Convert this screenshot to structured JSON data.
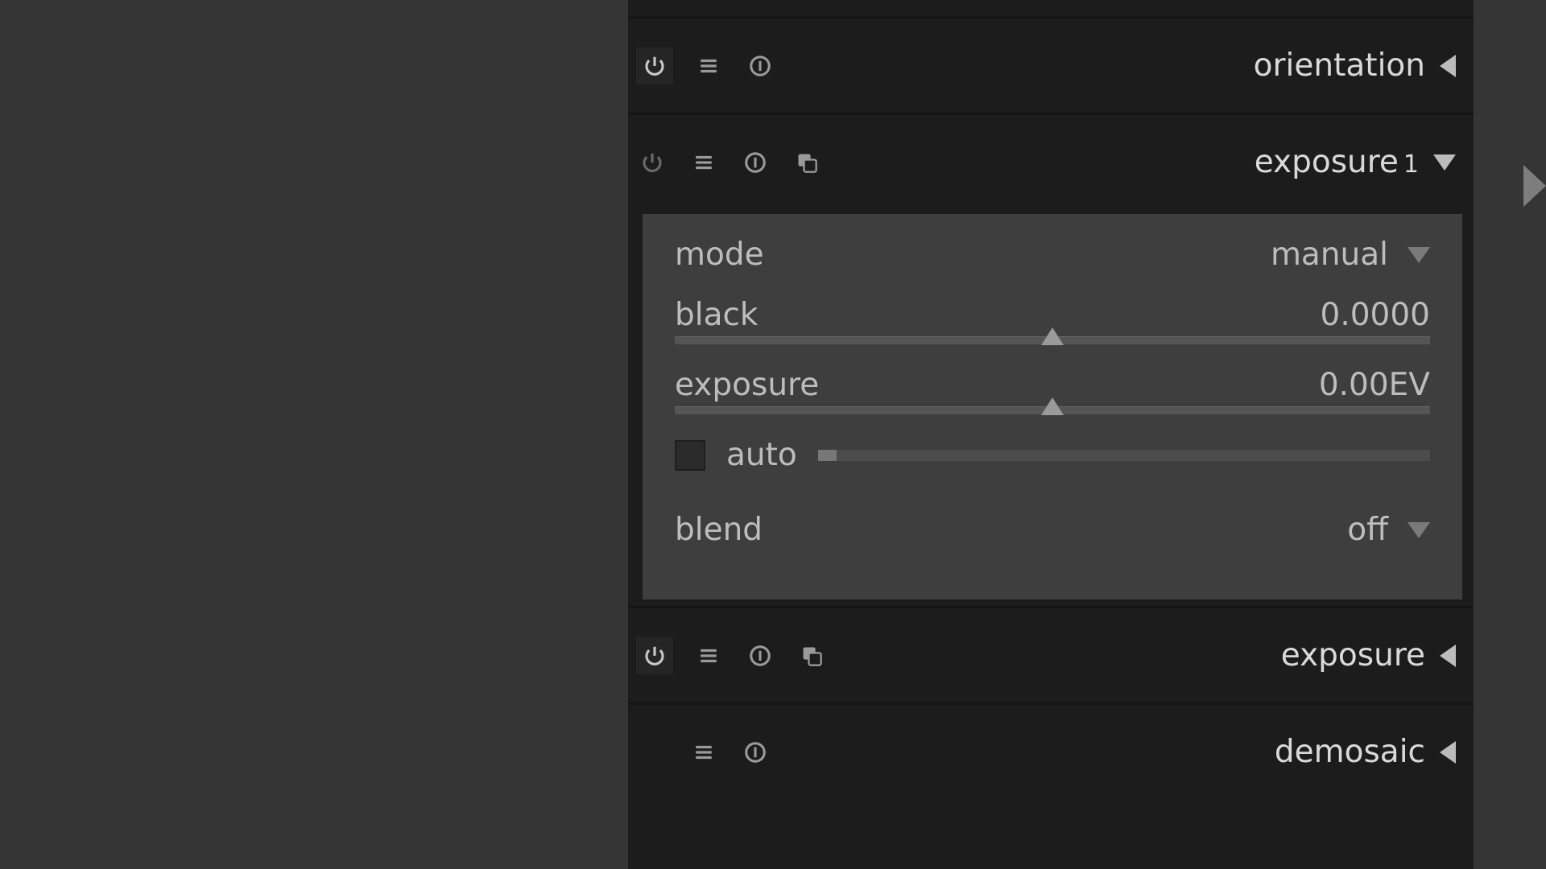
{
  "modules": {
    "orientation": {
      "title": "orientation",
      "expanded": false,
      "enabled": true
    },
    "exposure1": {
      "title": "exposure",
      "instance_num": "1",
      "expanded": true,
      "enabled": false,
      "mode_label": "mode",
      "mode_value": "manual",
      "black_label": "black",
      "black_value": "0.0000",
      "black_slider_pos": 0.5,
      "exposure_label": "exposure",
      "exposure_value": "0.00EV",
      "exposure_slider_pos": 0.5,
      "auto_label": "auto",
      "auto_checked": false,
      "auto_bar_fill": 0.03,
      "blend_label": "blend",
      "blend_value": "off"
    },
    "exposure": {
      "title": "exposure",
      "expanded": false,
      "enabled": true
    },
    "demosaic": {
      "title": "demosaic",
      "expanded": false,
      "enabled": true
    }
  }
}
